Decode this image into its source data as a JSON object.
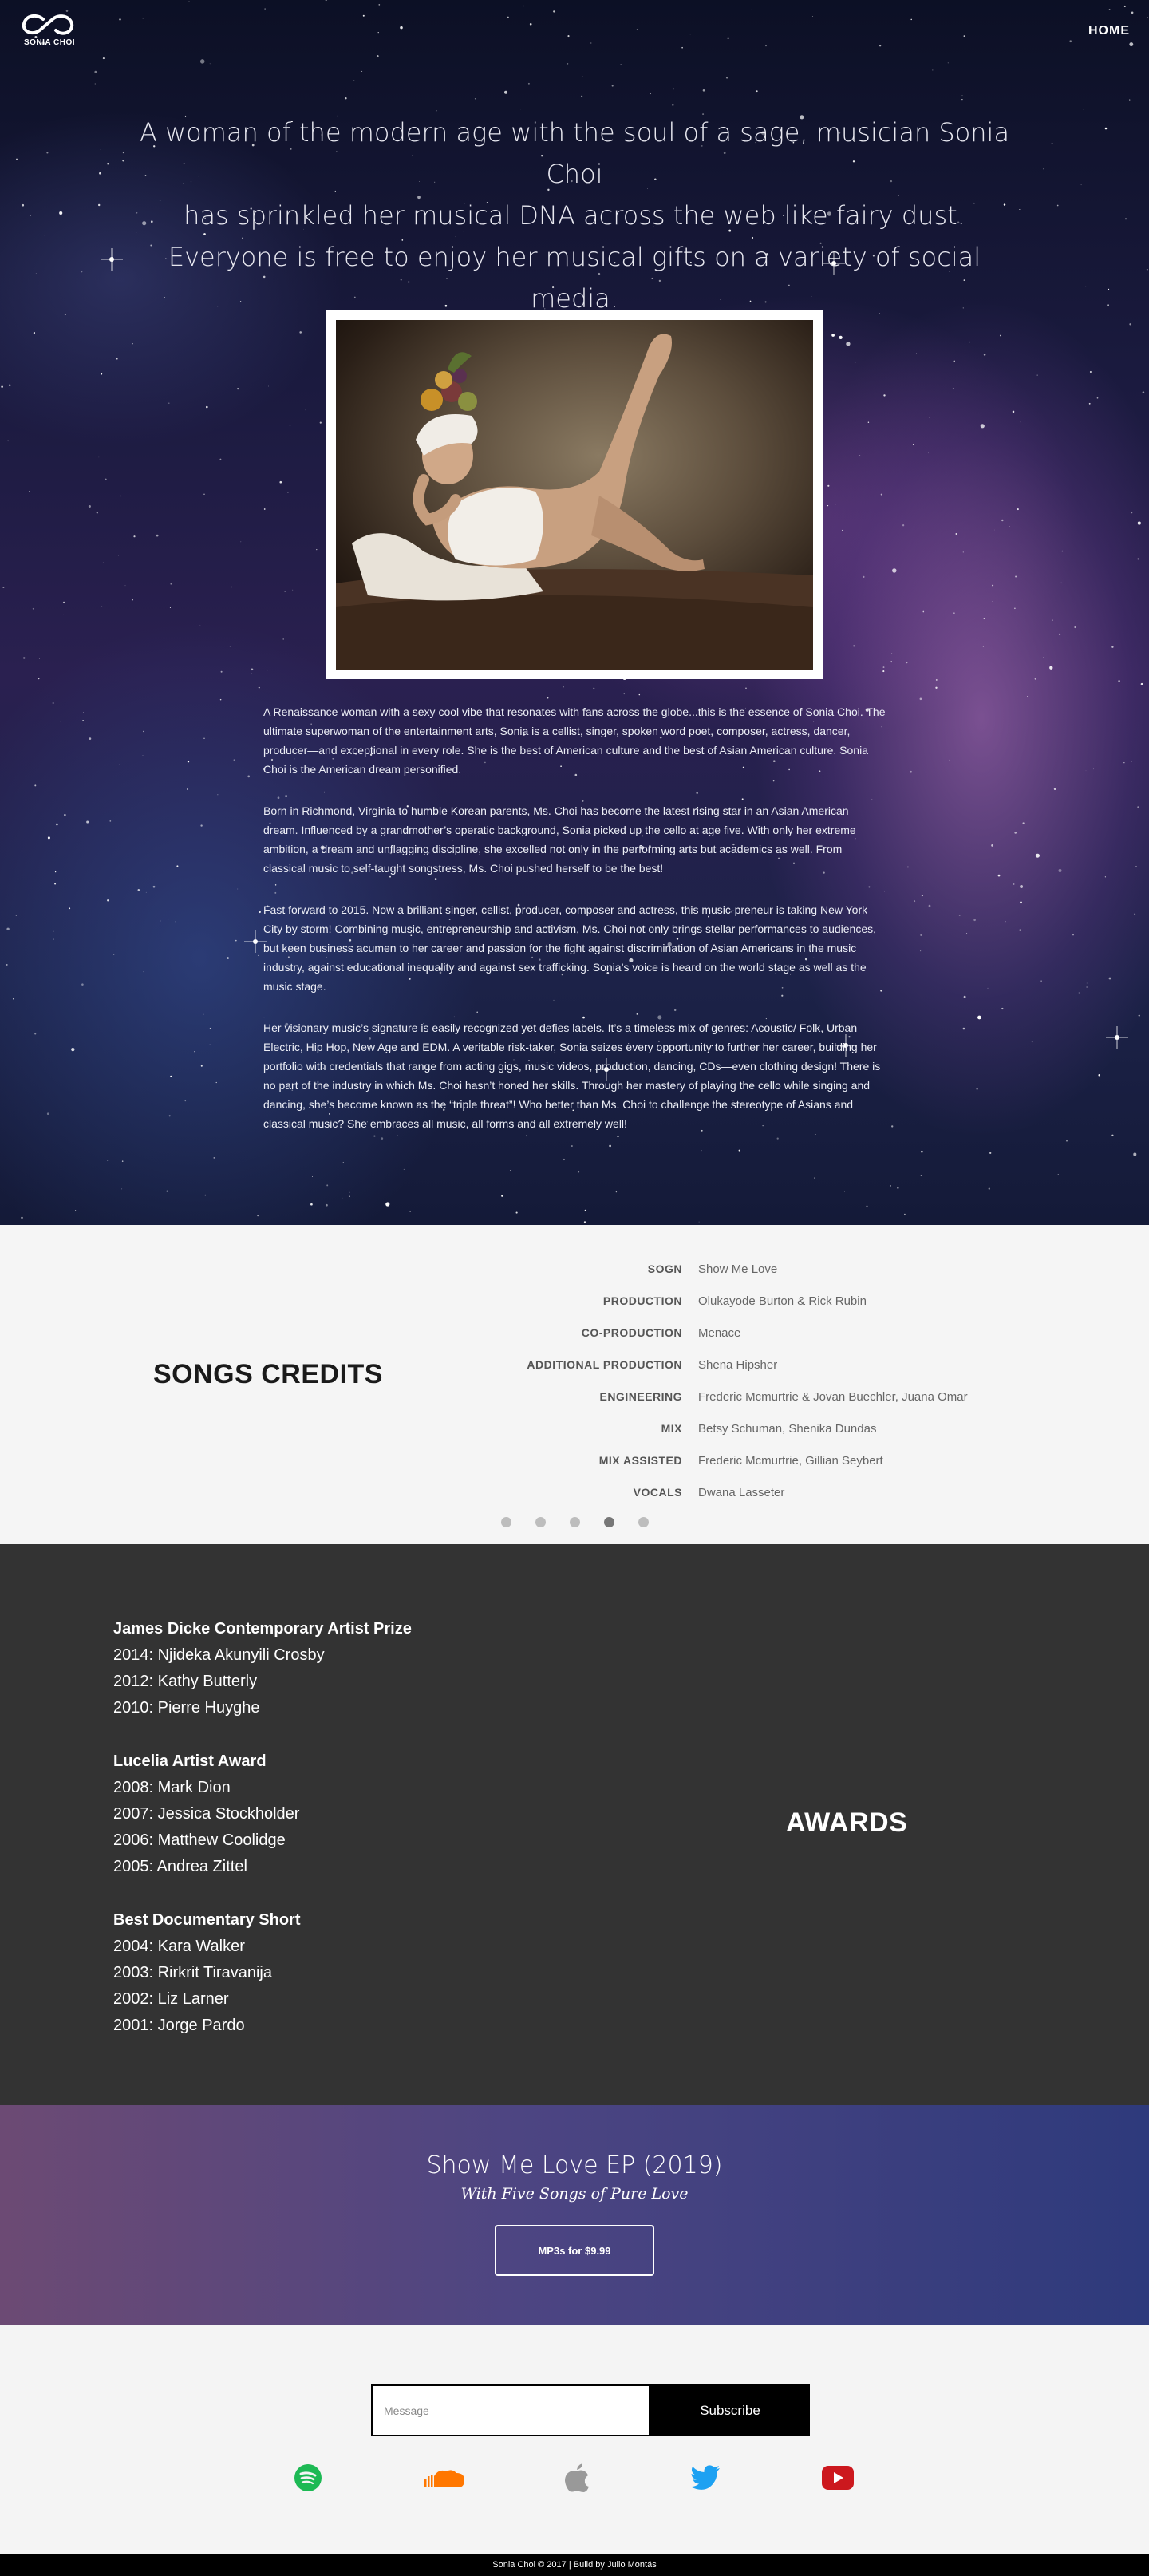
{
  "header": {
    "logo_text": "SONIA CHOI",
    "nav_home": "HOME"
  },
  "hero": {
    "intro_line1": "A woman of the modern age with the soul of a sage, musician Sonia Choi",
    "intro_line2": "has sprinkled her musical DNA across the web like fairy dust.",
    "intro_line3": "Everyone is free to enjoy her musical gifts on a variety of social media.",
    "bio": [
      "A Renaissance woman with a sexy cool vibe that resonates with fans across the globe...this is the essence of Sonia Choi.  The ultimate superwoman of the entertainment arts, Sonia is a cellist, singer, spoken word poet, composer, actress, dancer, producer—and exceptional in every role.  She is the best of American culture and the best of Asian American culture.  Sonia Choi is the American dream personified.",
      "Born in Richmond, Virginia to humble Korean parents, Ms. Choi has become the latest rising star in an Asian American dream.  Influenced by a grandmother’s operatic background, Sonia picked up the cello at age five.  With only her extreme ambition, a dream and unflagging discipline, she excelled not only in the performing arts but academics as well.  From classical music to self-taught songstress, Ms. Choi pushed herself to be the best!",
      "Fast forward to 2015.  Now a brilliant singer, cellist, producer, composer and actress, this music-preneur is taking New York City by storm!  Combining music, entrepreneurship and activism, Ms. Choi not only brings stellar performances to audiences, but keen business acumen to her career and passion for the fight against discrimination of Asian Americans in the music industry, against educational inequality and against sex trafficking.  Sonia’s voice is heard on the world stage as well as the music stage.",
      "Her visionary music’s signature is easily recognized yet defies labels.  It’s a timeless mix of genres:  Acoustic/ Folk, Urban Electric, Hip Hop, New Age and EDM.  A veritable risk-taker, Sonia seizes every opportunity to further her career, building her portfolio with credentials  that range from acting gigs, music videos, production, dancing, CDs—even clothing design!  There is no part of the industry in which Ms. Choi hasn’t honed her skills.  Through her mastery of playing the cello while singing and dancing, she’s become known as the “triple threat”!  Who better than Ms. Choi to challenge the stereotype of Asians and classical music?  She embraces all music, all forms and all extremely well!"
    ]
  },
  "credits": {
    "title": "SONGS CREDITS",
    "rows": [
      {
        "role": "SOGN",
        "name": "Show Me Love"
      },
      {
        "role": "PRODUCTION",
        "name": "Olukayode Burton & Rick Rubin"
      },
      {
        "role": "CO-PRODUCTION",
        "name": "Menace"
      },
      {
        "role": "ADDITIONAL PRODUCTION",
        "name": "Shena Hipsher"
      },
      {
        "role": "ENGINEERING",
        "name": "Frederic Mcmurtrie & Jovan Buechler, Juana Omar"
      },
      {
        "role": "MIX",
        "name": "Betsy Schuman, Shenika Dundas"
      },
      {
        "role": "MIX ASSISTED",
        "name": "Frederic Mcmurtrie, Gillian Seybert"
      },
      {
        "role": "VOCALS",
        "name": "Dwana Lasseter"
      }
    ],
    "active_slide": 4,
    "slide_count": 5
  },
  "awards": {
    "heading": "AWARDS",
    "groups": [
      {
        "title": "James Dicke Contemporary Artist Prize",
        "items": [
          "2014: Njideka Akunyili Crosby",
          "2012: Kathy Butterly",
          "2010: Pierre Huyghe"
        ]
      },
      {
        "title": "Lucelia Artist Award",
        "items": [
          "2008: Mark Dion",
          "2007: Jessica Stockholder",
          "2006: Matthew Coolidge",
          "2005: Andrea Zittel"
        ]
      },
      {
        "title": "Best Documentary Short",
        "items": [
          "2004: Kara Walker",
          "2003: Rirkrit Tiravanija",
          "2002: Liz Larner",
          "2001: Jorge Pardo"
        ]
      }
    ]
  },
  "ep": {
    "title": "Show Me Love EP (2019)",
    "subtitle": "With Five Songs of Pure Love",
    "button_label": "MP3s for $9.99"
  },
  "subscribe": {
    "placeholder": "Message",
    "button_label": "Subscribe"
  },
  "socials": [
    {
      "icon": "spotify-icon",
      "color": "#1db954"
    },
    {
      "icon": "soundcloud-icon",
      "color": "#ff7700"
    },
    {
      "icon": "apple-icon",
      "color": "#999999"
    },
    {
      "icon": "twitter-icon",
      "color": "#1da1f2"
    },
    {
      "icon": "youtube-icon",
      "color": "#cc181e"
    }
  ],
  "footer": {
    "text": "Sonia Choi © 2017 | Build by Julio Montás"
  }
}
